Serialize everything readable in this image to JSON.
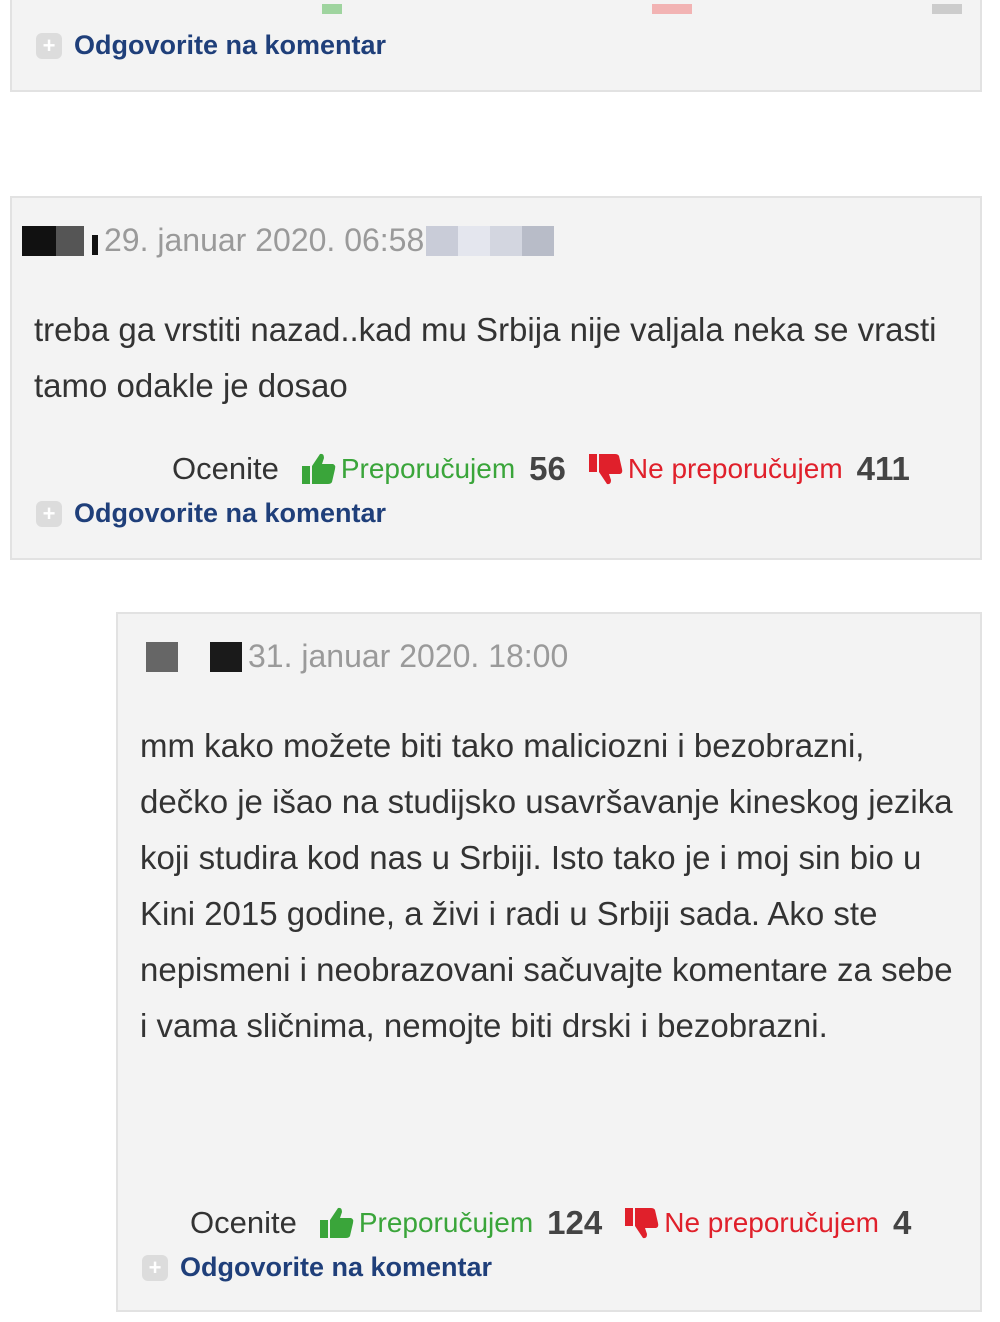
{
  "comments": [
    {
      "reply_label": "Odgovorite na komentar"
    },
    {
      "date": "29. januar 2020. 06:58",
      "text": "treba ga vrstiti nazad..kad mu Srbija nije valjala neka se vrasti tamo odakle je dosao",
      "rate_label": "Ocenite",
      "recommend_label": "Preporučujem",
      "recommend_count": "56",
      "not_recommend_label": "Ne preporučujem",
      "not_recommend_count": "411",
      "reply_label": "Odgovorite na komentar"
    },
    {
      "date": "31. januar 2020. 18:00",
      "text": "mm kako možete biti tako maliciozni i bezobrazni, dečko je išao na studijsko usavršavanje kineskog jezika koji studira kod nas u Srbiji. Isto tako je i moj sin bio u Kini 2015 godine, a živi i radi u Srbiji sada. Ako ste nepismeni i neobrazovani sačuvajte komentare za sebe i vama sličnima, nemojte biti drski i bezobrazni.",
      "rate_label": "Ocenite",
      "recommend_label": "Preporučujem",
      "recommend_count": "124",
      "not_recommend_label": "Ne preporučujem",
      "not_recommend_count": "4",
      "reply_label": "Odgovorite na komentar"
    }
  ],
  "colors": {
    "card_background": "#f3f3f3",
    "link": "#1f3f7a",
    "recommend": "#3aa53a",
    "not_recommend": "#e0202b",
    "date": "#9a9a9a"
  },
  "icons": [
    "plus-icon",
    "thumbs-up-icon",
    "thumbs-down-icon"
  ]
}
